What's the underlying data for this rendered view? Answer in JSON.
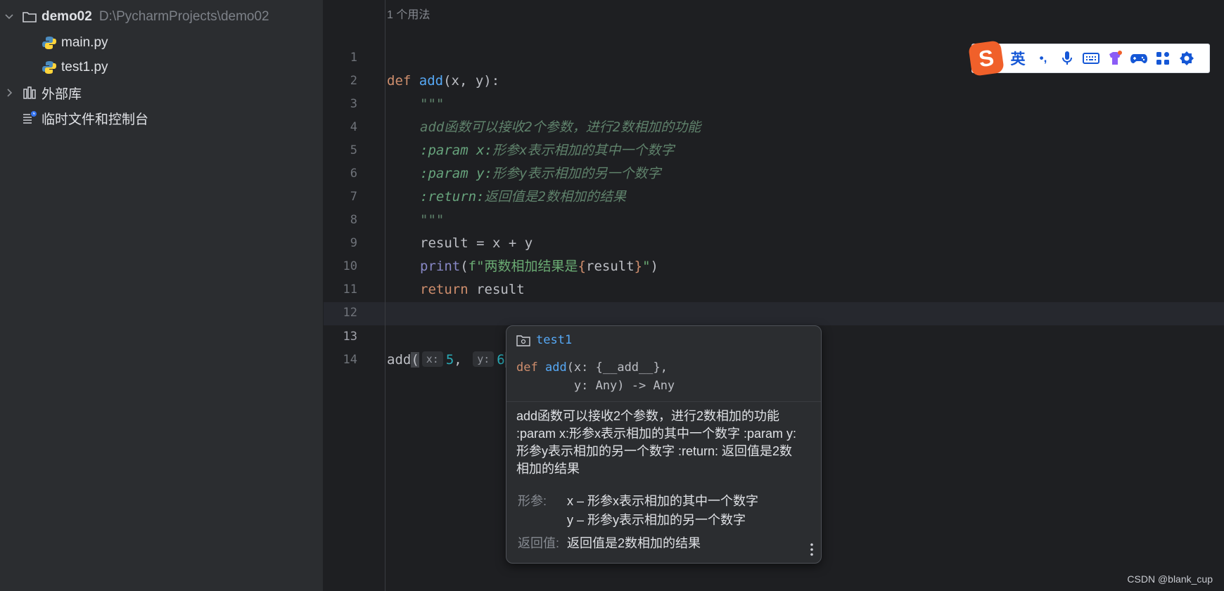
{
  "sidebar": {
    "project": {
      "name": "demo02",
      "path": "D:\\PycharmProjects\\demo02"
    },
    "files": [
      "main.py",
      "test1.py"
    ],
    "external_libs": "外部库",
    "scratches": "临时文件和控制台"
  },
  "editor": {
    "usage_hint": "1 个用法",
    "line_numbers": [
      "1",
      "2",
      "3",
      "4",
      "5",
      "6",
      "7",
      "8",
      "9",
      "10",
      "11",
      "12",
      "13",
      "14"
    ],
    "current_line": "13",
    "lines": {
      "l1": {
        "kw": "def",
        "fn": "add",
        "rest": "(x, y):"
      },
      "l2": "\"\"\"",
      "l3": "add函数可以接收2个参数，进行2数相加的功能",
      "l4": {
        "tag": ":param x:",
        "text": "形参x表示相加的其中一个数字"
      },
      "l5": {
        "tag": ":param y:",
        "text": "形参y表示相加的另一个数字"
      },
      "l6": {
        "tag": ":return:",
        "text": "返回值是2数相加的结果"
      },
      "l7": "\"\"\"",
      "l8": "result = x + y",
      "l9": {
        "builtin": "print",
        "open": "(",
        "str_prefix": "f\"两数相加结果是",
        "brace_open": "{",
        "var": "result",
        "brace_close": "}",
        "str_suffix": "\"",
        "close": ")"
      },
      "l10": {
        "kw": "return",
        "rest": " result"
      },
      "l13": {
        "call": "add",
        "open": "(",
        "hint_x": "x:",
        "val_x": "5",
        "comma": ",",
        "hint_y": "y:",
        "val_y": "6",
        "close": ")"
      }
    }
  },
  "doc_popup": {
    "module": "test1",
    "signature_line1": {
      "kw": "def",
      "fn": "add",
      "rest": "(x: {__add__},"
    },
    "signature_line2": "        y: Any) -> Any",
    "description": "add函数可以接收2个参数，进行2数相加的功能 :param x:形参x表示相加的其中一个数字 :param y:形参y表示相加的另一个数字 :return: 返回值是2数相加的结果",
    "params_label": "形参:",
    "param_x": "x – 形参x表示相加的其中一个数字",
    "param_y": "y – 形参y表示相加的另一个数字",
    "returns_label": "返回值:",
    "returns": "返回值是2数相加的结果"
  },
  "ime_toolbar": {
    "logo": "S",
    "mode": "英",
    "punct": "•,",
    "icons": [
      "mic-icon",
      "keyboard-icon",
      "skin-icon",
      "gamepad-icon",
      "apps-icon",
      "settings-icon"
    ]
  },
  "watermark": "CSDN @blank_cup",
  "colors": {
    "keyword": "#cf8e6d",
    "function": "#56a8f5",
    "docstring": "#5f826b",
    "number": "#2aacb8",
    "string": "#6aab73",
    "ime_accent": "#f0602a"
  }
}
